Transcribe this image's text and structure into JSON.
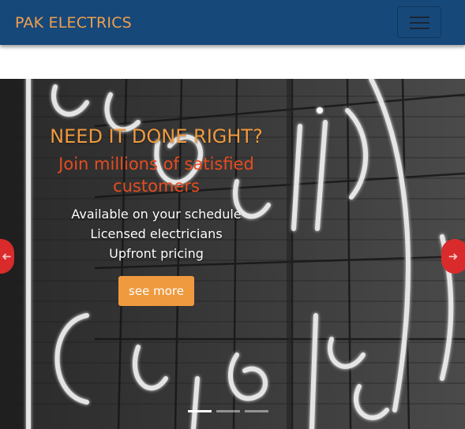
{
  "navbar": {
    "brand": "PAK ELECTRICS",
    "toggler_icon": "hamburger-icon",
    "brand_color": "#f0a04b",
    "background_color": "#17487a"
  },
  "hero": {
    "headline": "NEED IT DONE RIGHT?",
    "subheadline": "Join millions of satisfied customers",
    "features": [
      "Available on your schedule",
      "Licensed electricians",
      "Upfront pricing"
    ],
    "cta_label": "see more",
    "background_image": "neon-sign-repair-center-photo",
    "prev_icon": "arrow-left-icon",
    "next_icon": "arrow-right-icon",
    "slide_count": 3,
    "active_slide": 1,
    "colors": {
      "headline": "#ef9a3f",
      "subheadline": "#e84c1f",
      "cta": "#ef9a3f",
      "arrows": "#d92b2b"
    }
  }
}
